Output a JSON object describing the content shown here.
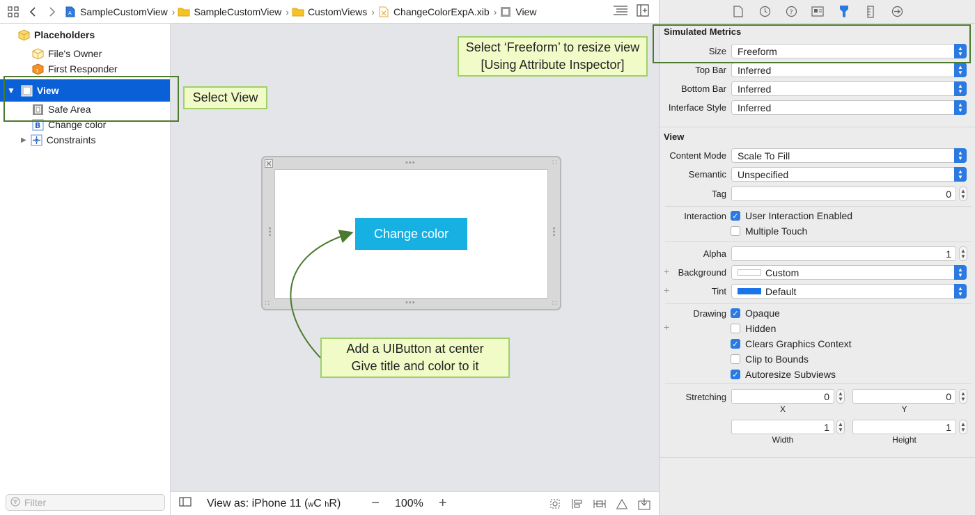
{
  "jumpbar": {
    "crumbs": [
      "SampleCustomView",
      "SampleCustomView",
      "CustomViews",
      "ChangeColorExpA.xib",
      "View"
    ]
  },
  "navigator": {
    "placeholders": "Placeholders",
    "files_owner": "File's Owner",
    "first_responder": "First Responder",
    "view": "View",
    "safe_area": "Safe Area",
    "change_color": "Change color",
    "constraints": "Constraints",
    "filter_placeholder": "Filter"
  },
  "canvas": {
    "button_title": "Change color",
    "button_color": "#16b0e2",
    "view_as": "View as: iPhone 11",
    "size_class_w": "w",
    "size_class_w_value": "C",
    "size_class_h": "h",
    "size_class_h_value": "R",
    "zoom": "100%"
  },
  "inspector": {
    "simulated_metrics": {
      "title": "Simulated Metrics",
      "size_label": "Size",
      "size_value": "Freeform",
      "top_bar_label": "Top Bar",
      "top_bar_value": "Inferred",
      "bottom_bar_label": "Bottom Bar",
      "bottom_bar_value": "Inferred",
      "interface_style_label": "Interface Style",
      "interface_style_value": "Inferred"
    },
    "view": {
      "title": "View",
      "content_mode_label": "Content Mode",
      "content_mode_value": "Scale To Fill",
      "semantic_label": "Semantic",
      "semantic_value": "Unspecified",
      "tag_label": "Tag",
      "tag_value": "0",
      "interaction_label": "Interaction",
      "user_interaction": "User Interaction Enabled",
      "user_interaction_checked": true,
      "multiple_touch": "Multiple Touch",
      "multiple_touch_checked": false,
      "alpha_label": "Alpha",
      "alpha_value": "1",
      "background_label": "Background",
      "background_value": "Custom",
      "tint_label": "Tint",
      "tint_value": "Default",
      "tint_color": "#1a73e8",
      "drawing_label": "Drawing",
      "opaque": "Opaque",
      "opaque_checked": true,
      "hidden": "Hidden",
      "hidden_checked": false,
      "clears_graphics": "Clears Graphics Context",
      "clears_graphics_checked": true,
      "clip_to_bounds": "Clip to Bounds",
      "clip_to_bounds_checked": false,
      "autoresize": "Autoresize Subviews",
      "autoresize_checked": true,
      "stretching_label": "Stretching",
      "stretch_x": "0",
      "stretch_y": "0",
      "stretch_width": "1",
      "stretch_height": "1",
      "x_label": "X",
      "y_label": "Y",
      "width_label": "Width",
      "height_label": "Height"
    }
  },
  "annotations": {
    "select_view": "Select View",
    "freeform_line1": "Select ‘Freeform’ to resize view",
    "freeform_line2": "[Using Attribute Inspector]",
    "button_line1": "Add a UIButton at center",
    "button_line2": "Give title and color to it"
  },
  "colors": {
    "selection": "#0a60d6",
    "accent": "#2a7ae2",
    "note_fill": "#f1fbc7",
    "note_border": "#9fd168",
    "highlight": "#4c7a2c"
  }
}
